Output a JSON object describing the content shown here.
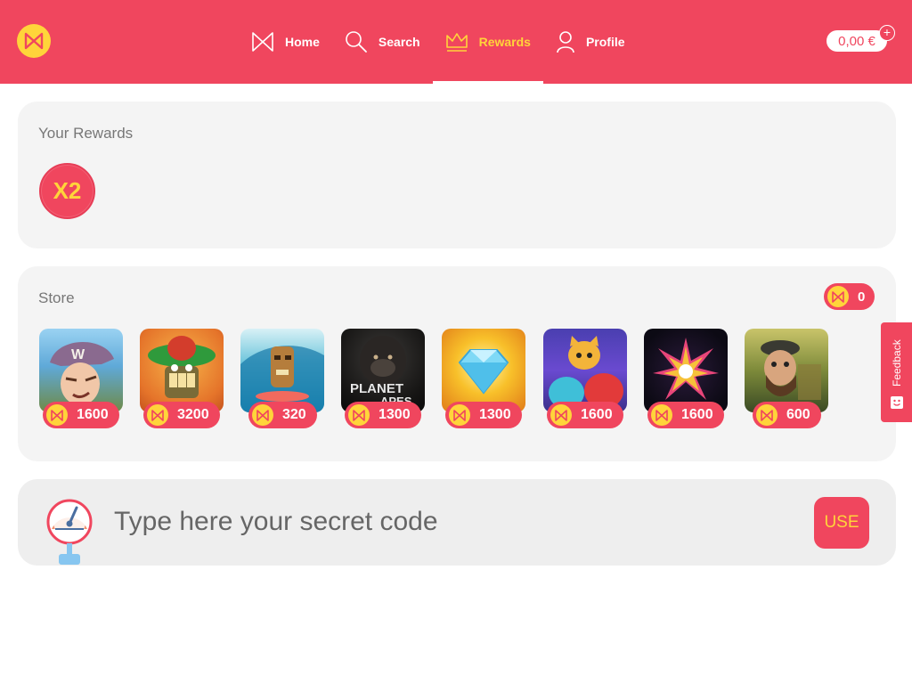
{
  "header": {
    "nav": [
      {
        "label": "Home",
        "icon": "bowtie-icon"
      },
      {
        "label": "Search",
        "icon": "search-icon"
      },
      {
        "label": "Rewards",
        "icon": "crown-icon",
        "active": true
      },
      {
        "label": "Profile",
        "icon": "user-icon"
      }
    ],
    "balance": "0,00 €",
    "balance_add": "+"
  },
  "rewards": {
    "title": "Your Rewards",
    "badge": "X2"
  },
  "store": {
    "title": "Store",
    "points": "0",
    "games": [
      {
        "price": "1600",
        "icon": "wild-pirate-game-icon"
      },
      {
        "price": "3200",
        "icon": "sombrero-slot-game-icon"
      },
      {
        "price": "320",
        "icon": "tiki-surf-game-icon"
      },
      {
        "price": "1300",
        "icon": "planet-of-the-apes-game-icon",
        "art_text": "PLANET",
        "art_text2": "APES"
      },
      {
        "price": "1300",
        "icon": "diamond-game-icon"
      },
      {
        "price": "1600",
        "icon": "cats-game-icon"
      },
      {
        "price": "1600",
        "icon": "starburst-game-icon"
      },
      {
        "price": "600",
        "icon": "gonzo-explorer-game-icon"
      }
    ]
  },
  "secret_code": {
    "placeholder": "Type here your secret code",
    "button_label": "USE"
  },
  "feedback": {
    "label": "Feedback"
  },
  "colors": {
    "brand": "#f0465e",
    "accent": "#ffd43a",
    "card": "#f4f4f4"
  }
}
